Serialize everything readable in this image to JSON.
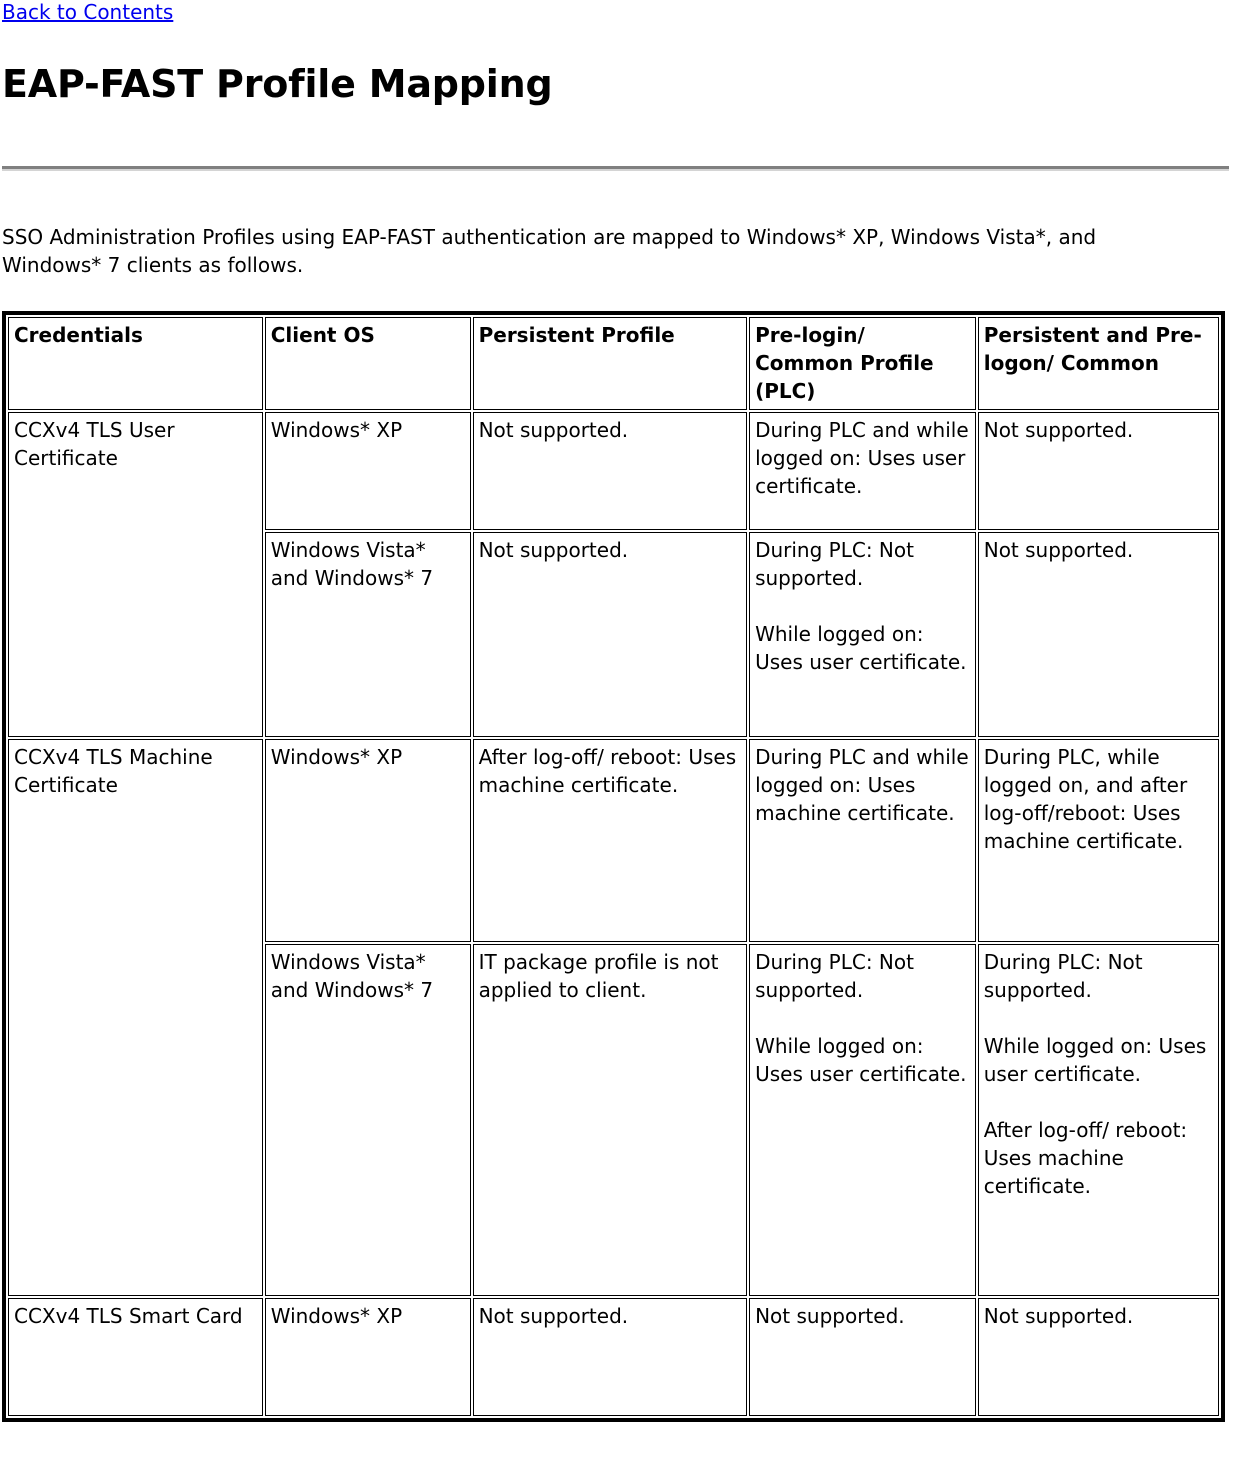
{
  "breadcrumb": {
    "back_link": "Back to Contents"
  },
  "header": {
    "title": "EAP-FAST Profile Mapping"
  },
  "intro": {
    "text": "SSO Administration Profiles using EAP-FAST authentication are mapped to Windows* XP, Windows Vista*, and Windows* 7 clients as follows."
  },
  "colors": {
    "link": "#0000EE",
    "text": "#000000",
    "border": "#000000",
    "rule_top": "#808080",
    "rule_bottom": "#D4D4D4",
    "background": "#FFFFFF"
  },
  "table": {
    "headers": [
      "Credentials",
      "Client OS",
      "Persistent Profile",
      "Pre-login/ Common Profile (PLC)",
      "Persistent and Pre-logon/ Common"
    ],
    "groups": [
      {
        "credentials": "CCXv4 TLS User Certificate",
        "rows": [
          {
            "client_os": "Windows* XP",
            "persistent_profile": [
              "Not supported."
            ],
            "plc": [
              "During PLC and while logged on: Uses user certificate."
            ],
            "persistent_prelogon": [
              "Not supported."
            ]
          },
          {
            "client_os": "Windows Vista* and Windows* 7",
            "persistent_profile": [
              "Not supported."
            ],
            "plc": [
              "During PLC: Not supported.",
              "While logged on: Uses user certificate."
            ],
            "persistent_prelogon": [
              "Not supported."
            ]
          }
        ]
      },
      {
        "credentials": "CCXv4 TLS Machine Certificate",
        "rows": [
          {
            "client_os": "Windows* XP",
            "persistent_profile": [
              "After log-off/ reboot: Uses machine certificate."
            ],
            "plc": [
              "During PLC and while logged on: Uses machine certificate."
            ],
            "persistent_prelogon": [
              "During PLC, while logged on, and after log-off/reboot: Uses machine certificate."
            ]
          },
          {
            "client_os": "Windows Vista* and Windows* 7",
            "persistent_profile": [
              "IT package profile is not applied to client."
            ],
            "plc": [
              "During PLC: Not supported.",
              "While logged on: Uses user certificate."
            ],
            "persistent_prelogon": [
              "During PLC: Not supported.",
              "While logged on: Uses user certificate.",
              "After log-off/ reboot: Uses machine certificate."
            ]
          }
        ]
      },
      {
        "credentials": "CCXv4 TLS Smart Card",
        "rows": [
          {
            "client_os": "Windows* XP",
            "persistent_profile": [
              "Not supported."
            ],
            "plc": [
              "Not supported."
            ],
            "persistent_prelogon": [
              "Not supported."
            ]
          }
        ]
      }
    ]
  }
}
